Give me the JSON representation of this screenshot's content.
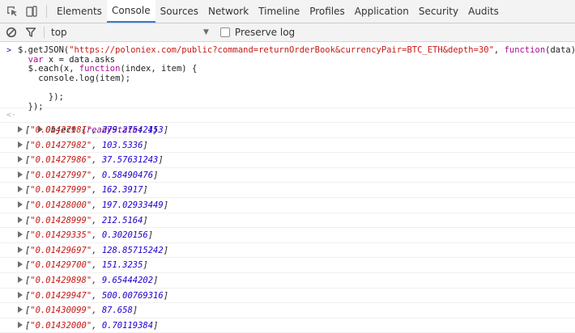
{
  "tabs": [
    "Elements",
    "Console",
    "Sources",
    "Network",
    "Timeline",
    "Profiles",
    "Application",
    "Security",
    "Audits"
  ],
  "active_tab": "Console",
  "filter": {
    "context": "top",
    "preserve_log_label": "Preserve log",
    "preserve_log_checked": false
  },
  "input_code": {
    "line1_prefix": "$.getJSON(",
    "line1_url": "\"https://poloniex.com/public?command=returnOrderBook&currencyPair=BTC_ETH&depth=30\"",
    "line1_sep": ", ",
    "line1_kw": "function",
    "line1_suffix": "(data){",
    "line2_kw": "  var",
    "line2_rest": " x = data.asks",
    "line3_prefix": "  $.each(x, ",
    "line3_kw": "function",
    "line3_suffix": "(index, item) {",
    "line4": "    console.log(item);",
    "line5": "",
    "line6": "      });",
    "line7": "  });"
  },
  "result": {
    "name": "Object",
    "open_brace": " {",
    "key": "readyState",
    "colon": ": ",
    "value": "1",
    "close_brace": "}"
  },
  "log_rows": [
    {
      "price": "\"0.01427981\"",
      "amount": "279.27542453"
    },
    {
      "price": "\"0.01427982\"",
      "amount": "103.5336"
    },
    {
      "price": "\"0.01427986\"",
      "amount": "37.57631243"
    },
    {
      "price": "\"0.01427997\"",
      "amount": "0.58490476"
    },
    {
      "price": "\"0.01427999\"",
      "amount": "162.3917"
    },
    {
      "price": "\"0.01428000\"",
      "amount": "197.02933449"
    },
    {
      "price": "\"0.01428999\"",
      "amount": "212.5164"
    },
    {
      "price": "\"0.01429335\"",
      "amount": "0.3020156"
    },
    {
      "price": "\"0.01429697\"",
      "amount": "128.85715242"
    },
    {
      "price": "\"0.01429700\"",
      "amount": "151.3235"
    },
    {
      "price": "\"0.01429898\"",
      "amount": "9.65444202"
    },
    {
      "price": "\"0.01429947\"",
      "amount": "500.00769316"
    },
    {
      "price": "\"0.01430099\"",
      "amount": "87.658"
    },
    {
      "price": "\"0.01432000\"",
      "amount": "0.70119384"
    }
  ],
  "icons": {
    "inspect": "inspect-element-icon",
    "device": "device-mode-icon",
    "clear": "clear-console-icon",
    "filter": "filter-icon"
  }
}
